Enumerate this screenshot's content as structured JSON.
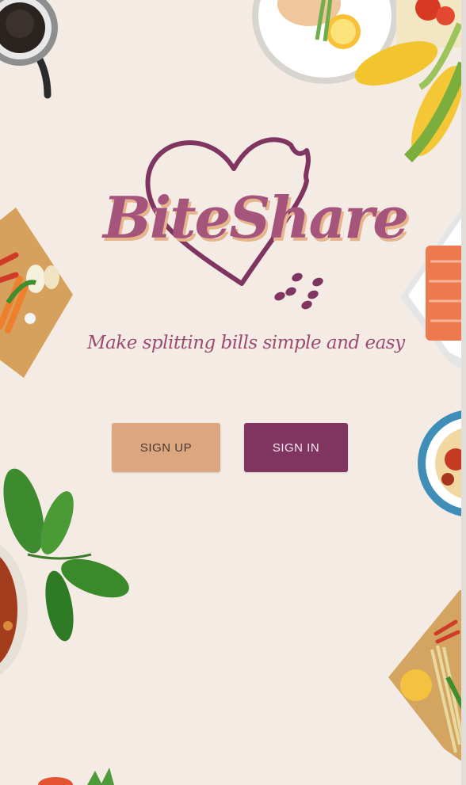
{
  "app": {
    "name": "BiteShare",
    "tagline": "Make splitting bills simple and easy"
  },
  "actions": {
    "sign_up_label": "SIGN UP",
    "sign_in_label": "SIGN IN"
  },
  "colors": {
    "background": "#f4ece4",
    "brand_plum": "#7f3560",
    "brand_pink": "#a5557b",
    "accent_peach": "#dca67f"
  },
  "decorations": [
    "coffee-cup-icon",
    "plate-of-fish-icon",
    "corn-icon",
    "cutting-board-vegetables-icon",
    "salmon-plate-icon",
    "basil-leaves-icon",
    "soup-bowl-icon",
    "spaghetti-bowl-icon",
    "noodle-board-icon"
  ]
}
